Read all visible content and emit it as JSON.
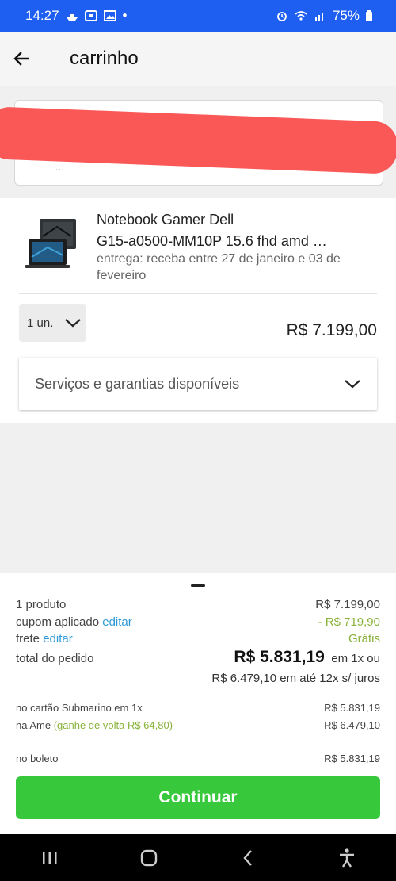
{
  "status_bar": {
    "time": "14:27",
    "dot": "•",
    "battery": "75%",
    "icons": [
      "ship-icon",
      "calendar-icon",
      "image-icon",
      "alarm-icon",
      "wifi-icon",
      "signal-icon",
      "battery-icon"
    ]
  },
  "app_bar": {
    "title": "carrinho",
    "back_icon": "arrow-left-icon"
  },
  "address": {
    "partial_text": "..."
  },
  "product": {
    "title_line1": "Notebook Gamer Dell",
    "title_line2": "G15-a0500-MM10P 15.6 fhd amd …",
    "delivery": "entrega: receba entre 27 de janeiro e 03 de fevereiro",
    "quantity": "1 un.",
    "price": "R$ 7.199,00",
    "services_label": "Serviços e garantias disponíveis"
  },
  "summary": {
    "products_label": "1 produto",
    "products_value": "R$ 7.199,00",
    "coupon_label": "cupom aplicado",
    "coupon_edit": "editar",
    "coupon_value": "- R$ 719,90",
    "shipping_label": "frete",
    "shipping_edit": "editar",
    "shipping_value": "Grátis",
    "total_label": "total do pedido",
    "total_value": "R$ 5.831,19",
    "total_suffix": "em 1x ou",
    "installments": "R$ 6.479,10 em até 12x s/ juros",
    "card_label": "no cartão Submarino em 1x",
    "card_value": "R$ 5.831,19",
    "ame_label": "na Ame",
    "ame_cashback": "(ganhe de volta R$ 64,80)",
    "ame_value": "R$ 6.479,10",
    "boleto_label": "no boleto",
    "boleto_value": "R$ 5.831,19",
    "continue_label": "Continuar"
  },
  "colors": {
    "status_bar": "#1e5ef0",
    "link": "#2c98d6",
    "cashback": "#8ab23a",
    "continue_button": "#37c93b",
    "redaction": "#fa5757"
  }
}
